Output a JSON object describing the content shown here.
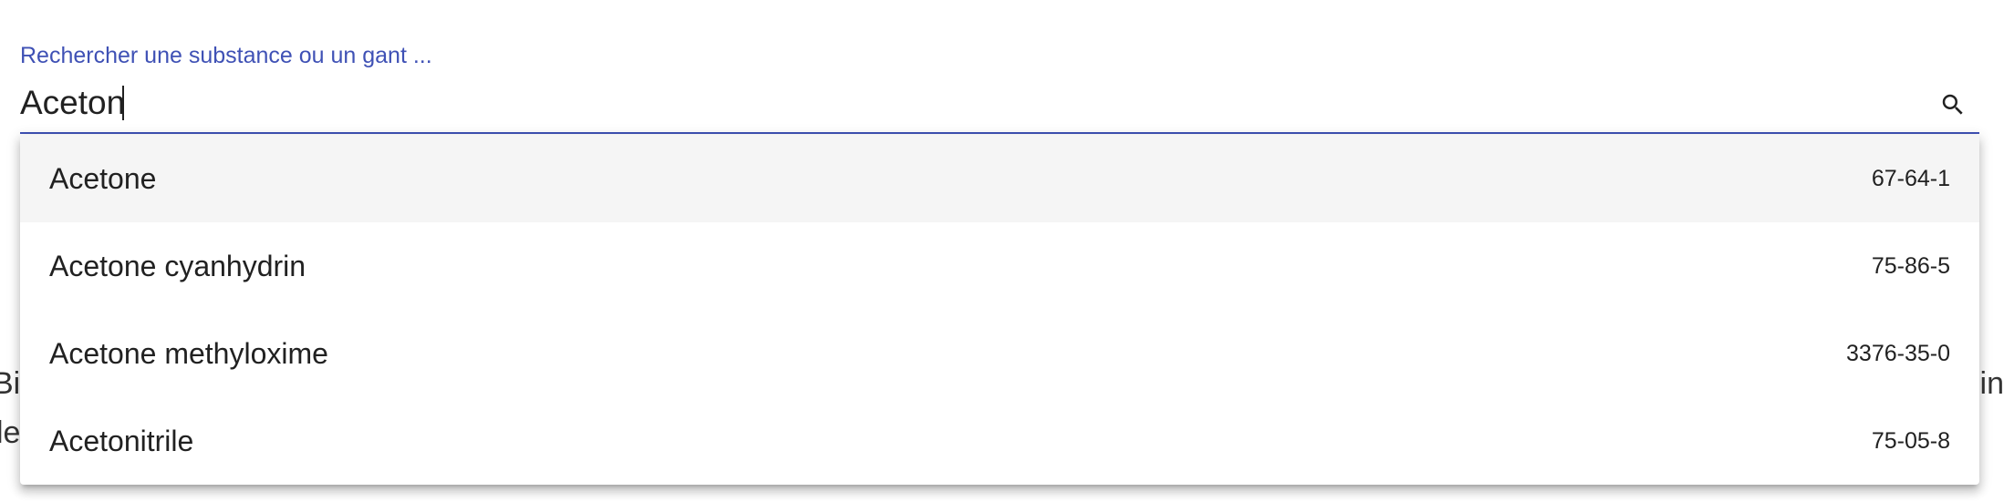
{
  "search": {
    "label": "Rechercher une substance ou un gant ...",
    "value": "Aceton",
    "icon": "search-icon",
    "accent_color": "#3f51b5"
  },
  "results": [
    {
      "name": "Acetone",
      "cas": "67-64-1",
      "highlighted": true
    },
    {
      "name": "Acetone cyanhydrin",
      "cas": "75-86-5",
      "highlighted": false
    },
    {
      "name": "Acetone methyloxime",
      "cas": "3376-35-0",
      "highlighted": false
    },
    {
      "name": "Acetonitrile",
      "cas": "75-05-8",
      "highlighted": false
    }
  ],
  "background": {
    "left_line_1": "Bi",
    "left_line_2": "le",
    "right_line_1": "in"
  }
}
